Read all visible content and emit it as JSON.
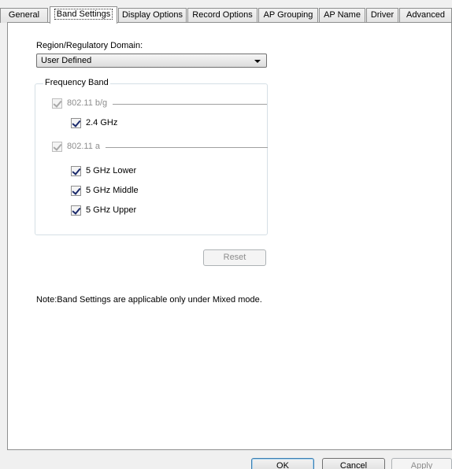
{
  "tabs": [
    {
      "label": "General",
      "active": false
    },
    {
      "label": "Band Settings",
      "active": true
    },
    {
      "label": "Display Options",
      "active": false
    },
    {
      "label": "Record Options",
      "active": false
    },
    {
      "label": "AP Grouping",
      "active": false
    },
    {
      "label": "AP Name",
      "active": false
    },
    {
      "label": "Driver",
      "active": false
    },
    {
      "label": "Advanced",
      "active": false
    }
  ],
  "region": {
    "label": "Region/Regulatory Domain:",
    "selected": "User Defined"
  },
  "frequency_band": {
    "title": "Frequency Band",
    "bg": {
      "label": "802.11 b/g",
      "checked": true,
      "enabled": false
    },
    "ghz24": {
      "label": "2.4 GHz",
      "checked": true
    },
    "a": {
      "label": "802.11 a",
      "checked": true,
      "enabled": false
    },
    "ghz5_lower": {
      "label": "5 GHz Lower",
      "checked": true
    },
    "ghz5_middle": {
      "label": "5 GHz Middle",
      "checked": true
    },
    "ghz5_upper": {
      "label": "5 GHz Upper",
      "checked": true
    }
  },
  "reset_label": "Reset",
  "note": "Note:Band Settings are applicable only under Mixed mode.",
  "footer": {
    "ok": "OK",
    "cancel": "Cancel",
    "apply": "Apply"
  },
  "colors": {
    "panel_bg": "#ffffff",
    "window_bg": "#f0f0f0",
    "check_mark": "#1b2a6b",
    "default_button_border": "#3c7fb1"
  }
}
